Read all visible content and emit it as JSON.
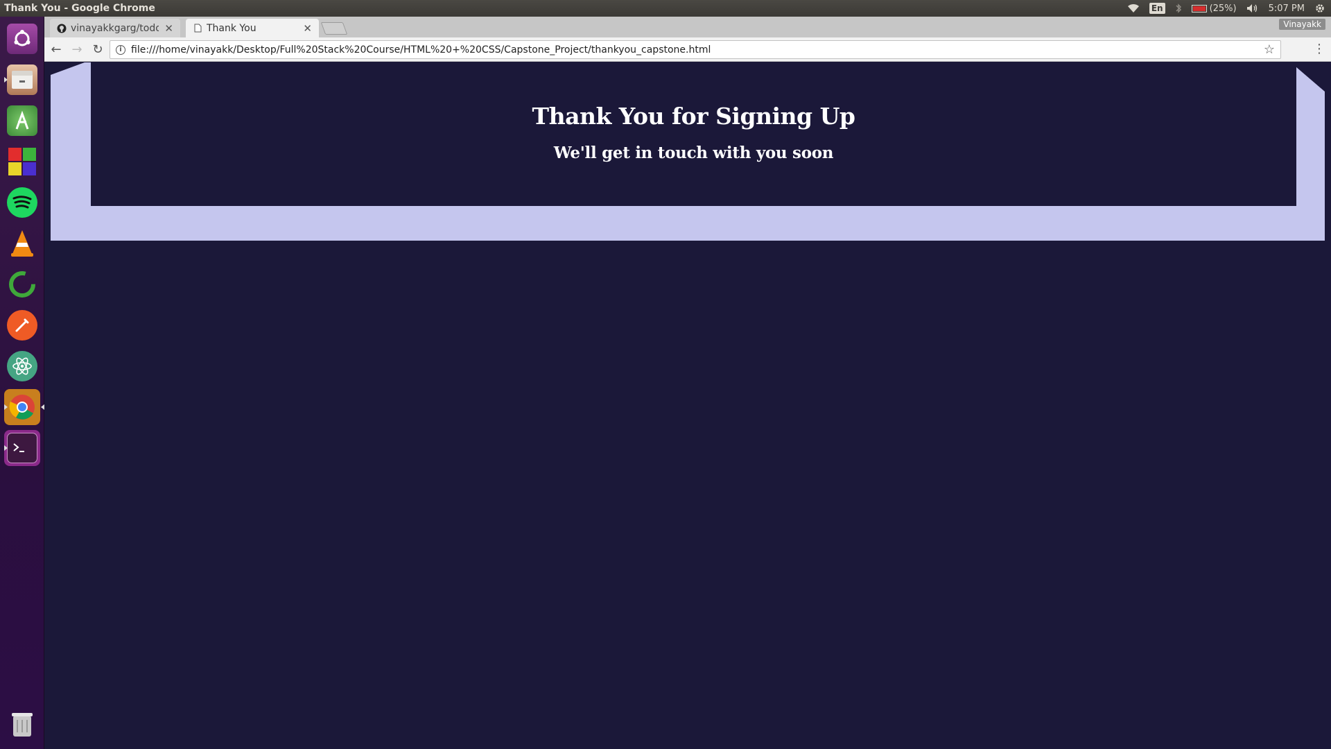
{
  "window": {
    "title": "Thank You - Google Chrome"
  },
  "tray": {
    "language": "En",
    "battery": "(25%)",
    "time": "5:07 PM"
  },
  "launcher": {
    "items": [
      {
        "name": "ubuntu-dash-icon"
      },
      {
        "name": "files-icon"
      },
      {
        "name": "android-studio-icon"
      },
      {
        "name": "windows-vm-icon"
      },
      {
        "name": "spotify-icon"
      },
      {
        "name": "vlc-icon"
      },
      {
        "name": "software-updater-icon"
      },
      {
        "name": "postman-icon"
      },
      {
        "name": "atom-icon"
      },
      {
        "name": "chrome-icon"
      },
      {
        "name": "terminal-icon"
      },
      {
        "name": "trash-icon"
      }
    ]
  },
  "browser": {
    "tabs": [
      {
        "label": "vinayakkgarg/todo",
        "icon": "github-icon",
        "active": false
      },
      {
        "label": "Thank You",
        "icon": "page-icon",
        "active": true
      }
    ],
    "profile": "Vinayakk",
    "url": "file:///home/vinayakk/Desktop/Full%20Stack%20Course/HTML%20+%20CSS/Capstone_Project/thankyou_capstone.html"
  },
  "page": {
    "title": "Thank You for Signing Up",
    "subtitle": "We'll get in touch with you soon"
  },
  "colors": {
    "page_background": "#1b1839",
    "banner_frame": "#c5c6ee",
    "text": "#ffffff"
  }
}
